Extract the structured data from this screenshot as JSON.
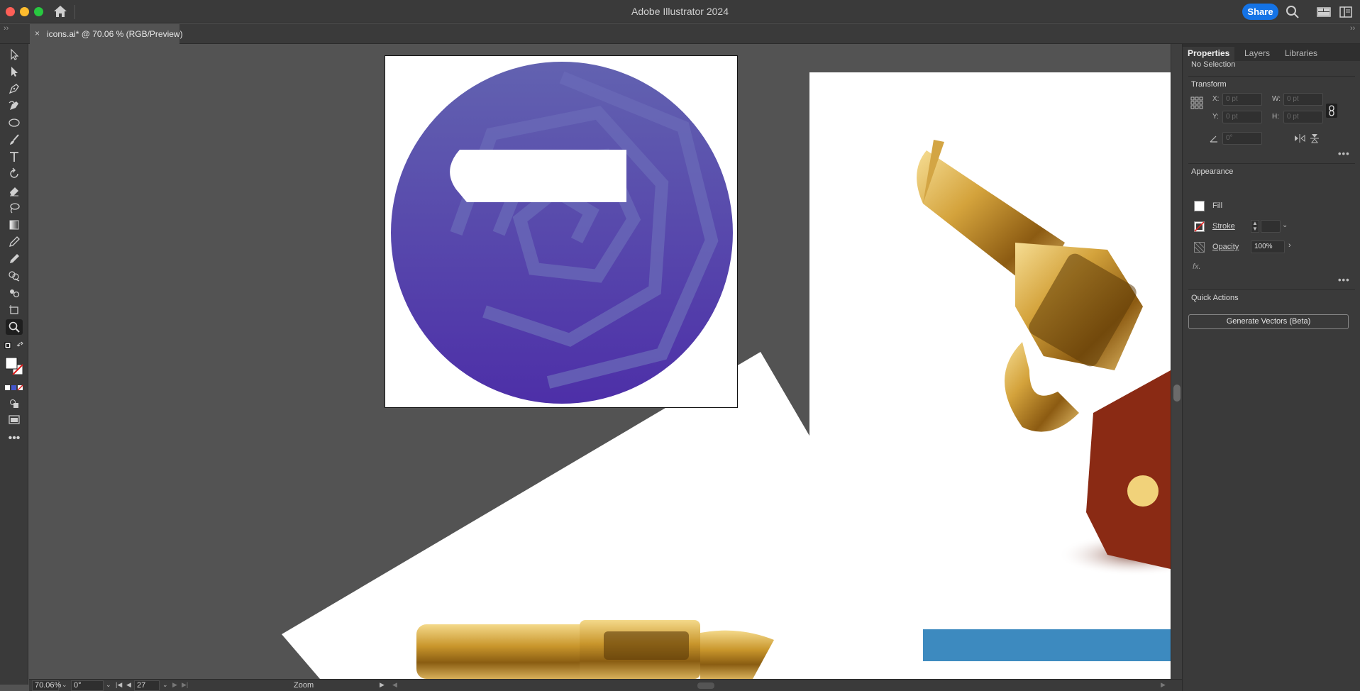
{
  "window": {
    "title": "Adobe Illustrator 2024",
    "share_label": "Share",
    "collapse_left": "››",
    "collapse_right": "››"
  },
  "document_tab": {
    "close": "×",
    "label": "icons.ai* @ 70.06 % (RGB/Preview)"
  },
  "toolbar": {
    "tools": [
      "selection-tool",
      "direct-selection-tool",
      "pen-tool",
      "curvature-tool",
      "ellipse-tool",
      "paintbrush-tool",
      "type-tool",
      "rotate-tool",
      "eraser-tool",
      "lasso-tool",
      "gradient-tool",
      "eyedropper-tool",
      "blend-tool",
      "shape-builder-tool",
      "artboard-tool",
      "zoom-tool"
    ],
    "active_tool": "zoom-tool",
    "more": "•••"
  },
  "properties_panel": {
    "tabs": [
      {
        "label": "Properties",
        "active": true
      },
      {
        "label": "Layers",
        "active": false
      },
      {
        "label": "Libraries",
        "active": false
      }
    ],
    "selection_status": "No Selection",
    "transform": {
      "heading": "Transform",
      "x_label": "X:",
      "x_value": "0 pt",
      "y_label": "Y:",
      "y_value": "0 pt",
      "w_label": "W:",
      "w_value": "0 pt",
      "h_label": "H:",
      "h_value": "0 pt",
      "angle_value": "0°"
    },
    "appearance": {
      "heading": "Appearance",
      "fill_label": "Fill",
      "stroke_label": "Stroke",
      "opacity_label": "Opacity",
      "opacity_value": "100%",
      "fx_label": "fx."
    },
    "quick_actions": {
      "heading": "Quick Actions",
      "generate_button": "Generate Vectors (Beta)"
    },
    "more": "•••"
  },
  "status_bar": {
    "zoom": "70.06%",
    "rotation": "0°",
    "artboard_number": "27",
    "current_tool": "Zoom"
  },
  "colors": {
    "accent": "#1473e6",
    "icon_circle_top": "#6262b0",
    "icon_circle_bottom": "#4d2fa8",
    "canvas_bg": "#535353",
    "panel_bg": "#3a3a3a",
    "blue_strip": "#3d8abf"
  }
}
